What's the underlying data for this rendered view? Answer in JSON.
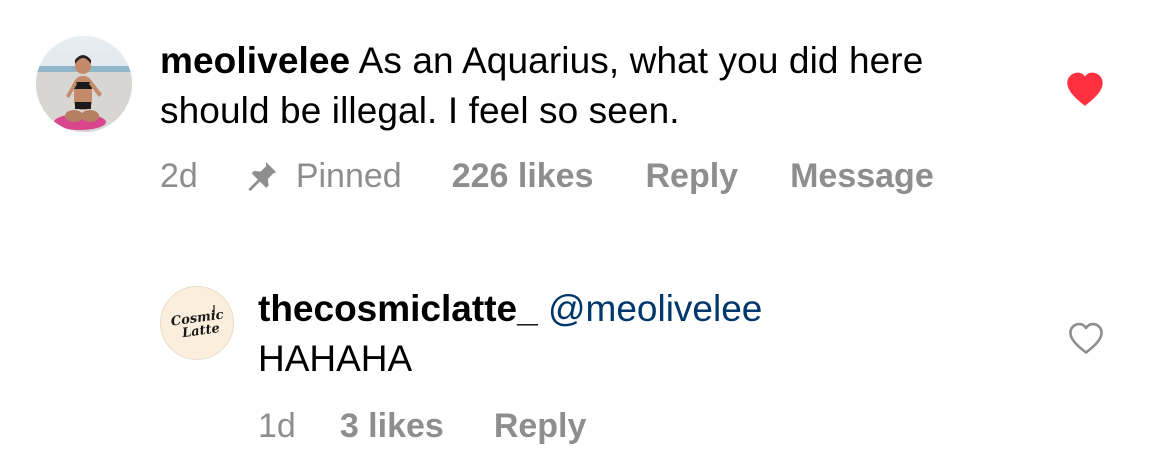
{
  "comments": [
    {
      "username": "meolivelee",
      "text": "As an Aquarius, what you did here should be illegal. I feel so seen.",
      "time": "2d",
      "pinned_label": "Pinned",
      "likes": "226 likes",
      "reply_label": "Reply",
      "message_label": "Message",
      "liked": true,
      "avatar_icon": "profile-photo-beach"
    },
    {
      "username": "thecosmiclatte_",
      "mention": "@meolivelee",
      "text": "HAHAHA",
      "time": "1d",
      "likes": "3 likes",
      "reply_label": "Reply",
      "liked": false,
      "avatar_logo_text": "Cosmic Latte"
    }
  ],
  "colors": {
    "heart_liked": "#ff3040",
    "meta_gray": "#8e8e8e",
    "mention_blue": "#00376b",
    "text": "#000000"
  }
}
